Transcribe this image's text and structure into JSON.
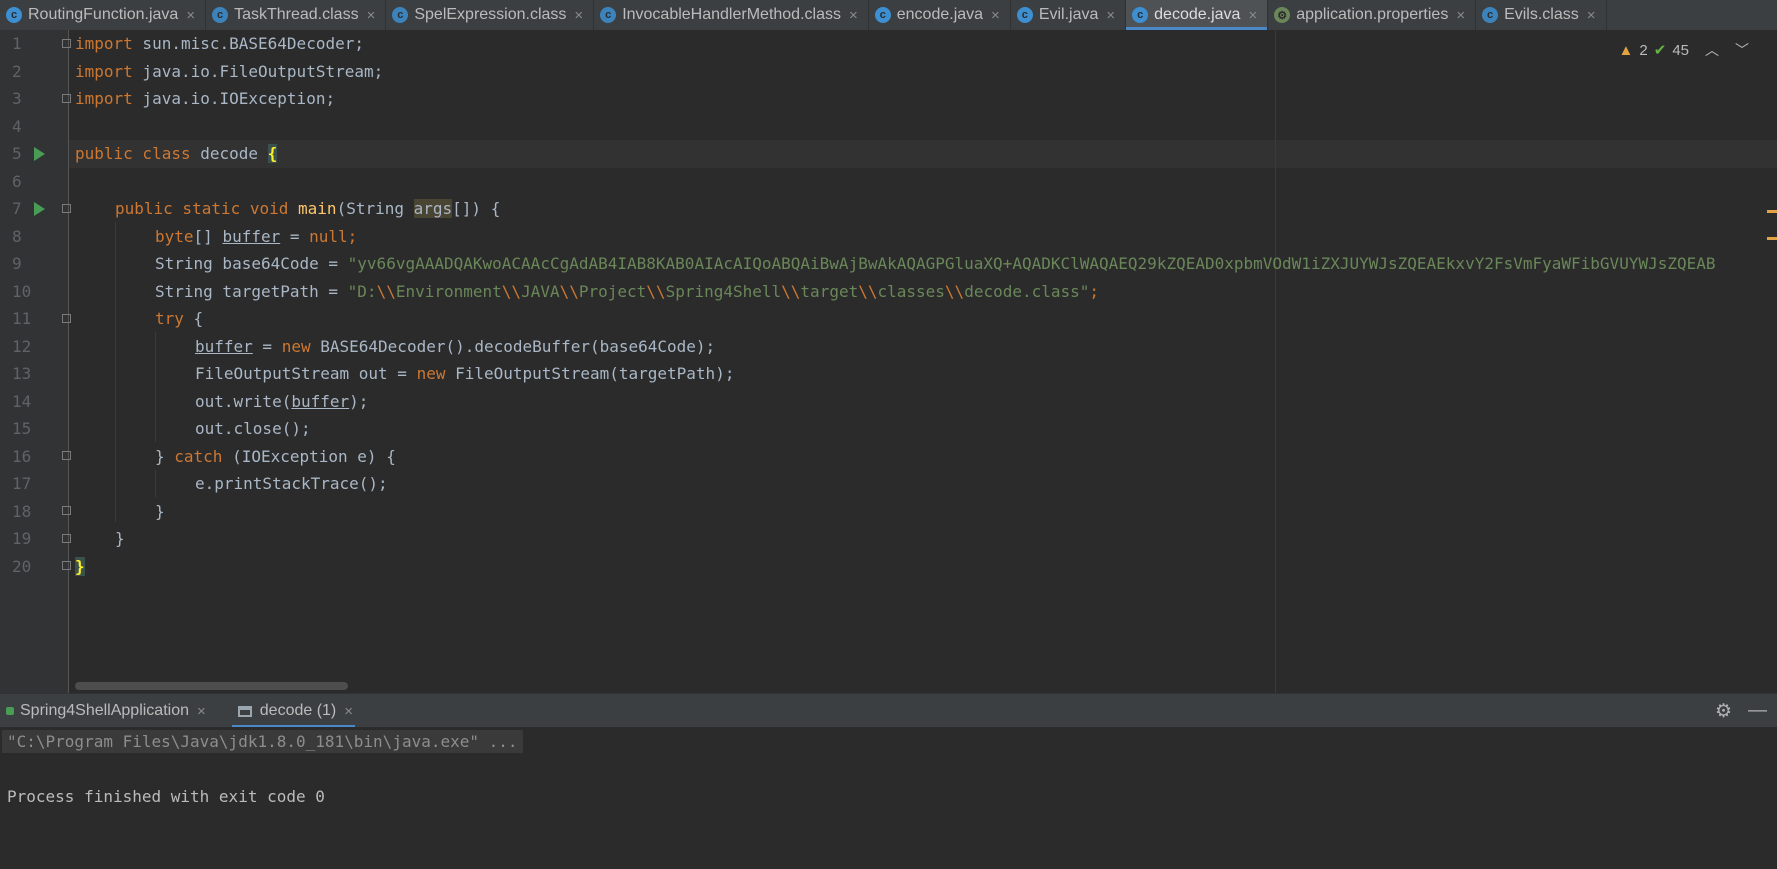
{
  "tabs": [
    {
      "label": "RoutingFunction.java",
      "icon": "java-class-icon",
      "active": false
    },
    {
      "label": "TaskThread.class",
      "icon": "compiled-class-icon",
      "active": false
    },
    {
      "label": "SpelExpression.class",
      "icon": "compiled-class-icon",
      "active": false
    },
    {
      "label": "InvocableHandlerMethod.class",
      "icon": "compiled-class-icon",
      "active": false
    },
    {
      "label": "encode.java",
      "icon": "java-class-icon",
      "active": false
    },
    {
      "label": "Evil.java",
      "icon": "java-class-icon",
      "active": false
    },
    {
      "label": "decode.java",
      "icon": "java-class-icon",
      "active": true
    },
    {
      "label": "application.properties",
      "icon": "properties-file-icon",
      "active": false
    },
    {
      "label": "Evils.class",
      "icon": "compiled-class-icon",
      "active": false
    }
  ],
  "inspection": {
    "warnings": "2",
    "typos": "45"
  },
  "editor": {
    "line_numbers": [
      "1",
      "2",
      "3",
      "4",
      "5",
      "6",
      "7",
      "8",
      "9",
      "10",
      "11",
      "12",
      "13",
      "14",
      "15",
      "16",
      "17",
      "18",
      "19",
      "20"
    ],
    "lines": {
      "l1": {
        "kw": "import",
        "rest": " sun.misc.BASE64Decoder;"
      },
      "l2": {
        "kw": "import",
        "rest": " java.io.FileOutputStream;"
      },
      "l3": {
        "kw": "import",
        "rest": " java.io.IOException;"
      },
      "l5": {
        "kw": "public class",
        "name": " decode ",
        "brace": "{"
      },
      "l7": {
        "kw": "public static void",
        "fn": "main",
        "open": "(String ",
        "param": "args",
        "close": "[]) {"
      },
      "l8": {
        "kw": "byte",
        "a": "[] ",
        "var": "buffer",
        "eq": " = ",
        "nul": "null",
        "semi": ";"
      },
      "l9": {
        "a": "String base64Code = ",
        "str": "\"yv66vgAAADQAKwoACAAcCgAdAB4IAB8KAB0AIAcAIQoABQAiBwAjBwAkAQAGPGluaXQ+AQADKClWAQAEQ29kZQEAD0xpbmVOdW1iZXJUYWJsZQEAEkxvY2FsVmFyaWFibGVUYWJsZQEAB"
      },
      "l10": {
        "a": "String targetPath = ",
        "s1": "\"D:",
        "e": "\\\\",
        "s2": "Environment",
        "s3": "JAVA",
        "s4": "Project",
        "s5": "Spring4Shell",
        "s6": "target",
        "s7": "classes",
        "s8": "decode.class\"",
        "semi": ";"
      },
      "l11": {
        "kw": "try",
        "rest": " {"
      },
      "l12": {
        "var": "buffer",
        "a": " = ",
        "kw": "new",
        "b": " BASE64Decoder().decodeBuffer(base64Code);"
      },
      "l13": {
        "a": "FileOutputStream out = ",
        "kw": "new",
        "b": " FileOutputStream(targetPath);"
      },
      "l14": {
        "a": "out.write(",
        "var": "buffer",
        "b": ");"
      },
      "l15": {
        "a": "out.close();"
      },
      "l16": {
        "a": "} ",
        "kw": "catch",
        "b": " (IOException e) {"
      },
      "l17": {
        "a": "e.printStackTrace();"
      },
      "l18": {
        "a": "}"
      },
      "l19": {
        "a": "}"
      },
      "l20": {
        "a": "}"
      }
    }
  },
  "run_panel": {
    "tabs": [
      {
        "label": "Spring4ShellApplication",
        "active": false
      },
      {
        "label": "decode (1)",
        "active": true
      }
    ],
    "command": "\"C:\\Program Files\\Java\\jdk1.8.0_181\\bin\\java.exe\" ...",
    "exit_message": "Process finished with exit code 0"
  }
}
